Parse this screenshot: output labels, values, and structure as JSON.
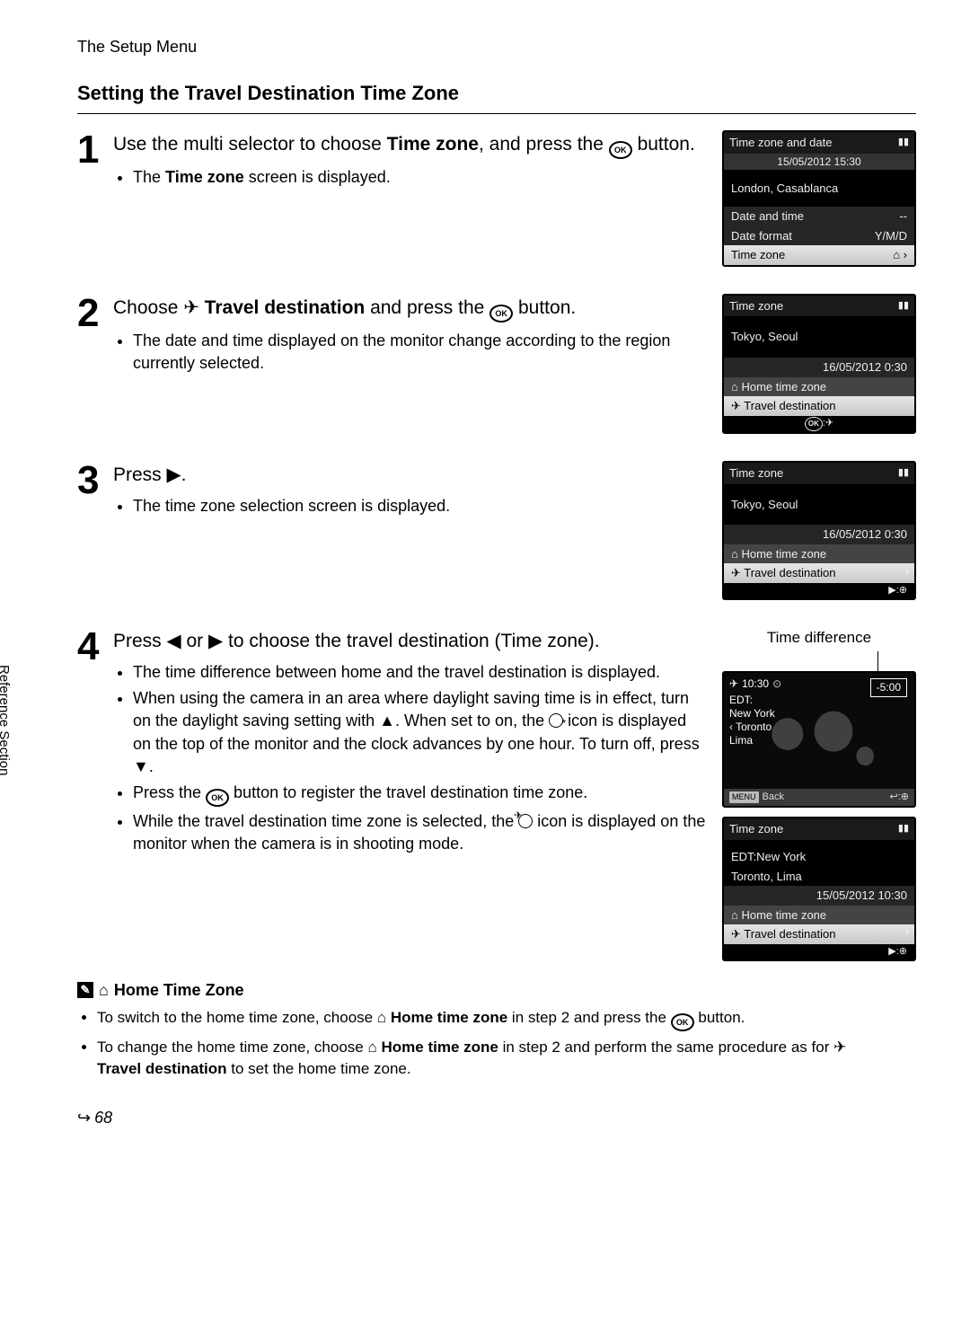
{
  "header": "The Setup Menu",
  "title": "Setting the Travel Destination Time Zone",
  "sidebar_text": "Reference Section",
  "page_number": "68",
  "steps": {
    "s1": {
      "num": "1",
      "head_a": "Use the multi selector to choose ",
      "bold_a": "Time zone",
      "head_b": ", and press the ",
      "head_c": " button.",
      "b1_a": "The ",
      "b1_bold": "Time zone",
      "b1_b": " screen is displayed."
    },
    "s2": {
      "num": "2",
      "head_a": "Choose ",
      "bold_a": "Travel destination",
      "head_b": " and press the ",
      "head_c": " button.",
      "b1": "The date and time displayed on the monitor change according to the region currently selected."
    },
    "s3": {
      "num": "3",
      "head_a": "Press ",
      "head_b": ".",
      "b1": "The time zone selection screen is displayed."
    },
    "s4": {
      "num": "4",
      "head_a": "Press ",
      "head_b": " or ",
      "head_c": " to choose the travel destination (Time zone).",
      "b1": "The time difference between home and the travel destination is displayed.",
      "b2_a": "When using the camera in an area where daylight saving time is in effect, turn on the daylight saving setting with ",
      "b2_b": ". When set to on, the ",
      "b2_c": " icon is displayed on the top of the monitor and the clock advances by one hour. To turn off, press ",
      "b2_d": ".",
      "b3_a": "Press the ",
      "b3_b": " button to register the travel destination time zone.",
      "b4_a": "While the travel destination time zone is selected, the ",
      "b4_b": " icon is displayed on the monitor when the camera is in shooting mode."
    }
  },
  "lcd1": {
    "title": "Time zone and date",
    "dt": "15/05/2012  15:30",
    "city": "London, Casablanca",
    "r1": "Date and time",
    "r1v": "--",
    "r2": "Date format",
    "r2v": "Y/M/D",
    "r3": "Time zone"
  },
  "lcd2": {
    "title": "Time zone",
    "city": "Tokyo, Seoul",
    "dt": "16/05/2012  0:30",
    "home": "Home time zone",
    "travel": "Travel destination",
    "foot_ok": "OK",
    "foot_plane": ":✈"
  },
  "lcd3": {
    "title": "Time zone",
    "city": "Tokyo, Seoul",
    "dt": "16/05/2012  0:30",
    "home": "Home time zone",
    "travel": "Travel destination",
    "foot": "▶:⊕"
  },
  "map": {
    "label": "Time difference",
    "time": "10:30",
    "diff": "-5:00",
    "c1": "EDT:",
    "c2": "New York",
    "c3": "Toronto",
    "c4": "Lima",
    "back": "Back",
    "br": "↩:⊕"
  },
  "lcd4": {
    "title": "Time zone",
    "city1": "EDT:New York",
    "city2": "Toronto, Lima",
    "dt": "15/05/2012  10:30",
    "home": "Home time zone",
    "travel": "Travel destination",
    "foot": "▶:⊕"
  },
  "note": {
    "title": "Home Time Zone",
    "b1_a": "To switch to the home time zone, choose ",
    "b1_bold": "Home time zone",
    "b1_b": " in step 2 and press the ",
    "b1_c": " button.",
    "b2_a": "To change the home time zone, choose ",
    "b2_bold": "Home time zone",
    "b2_b": " in step 2 and perform the same procedure as for ",
    "b2_bold2": "Travel destination",
    "b2_c": " to set the home time zone."
  }
}
